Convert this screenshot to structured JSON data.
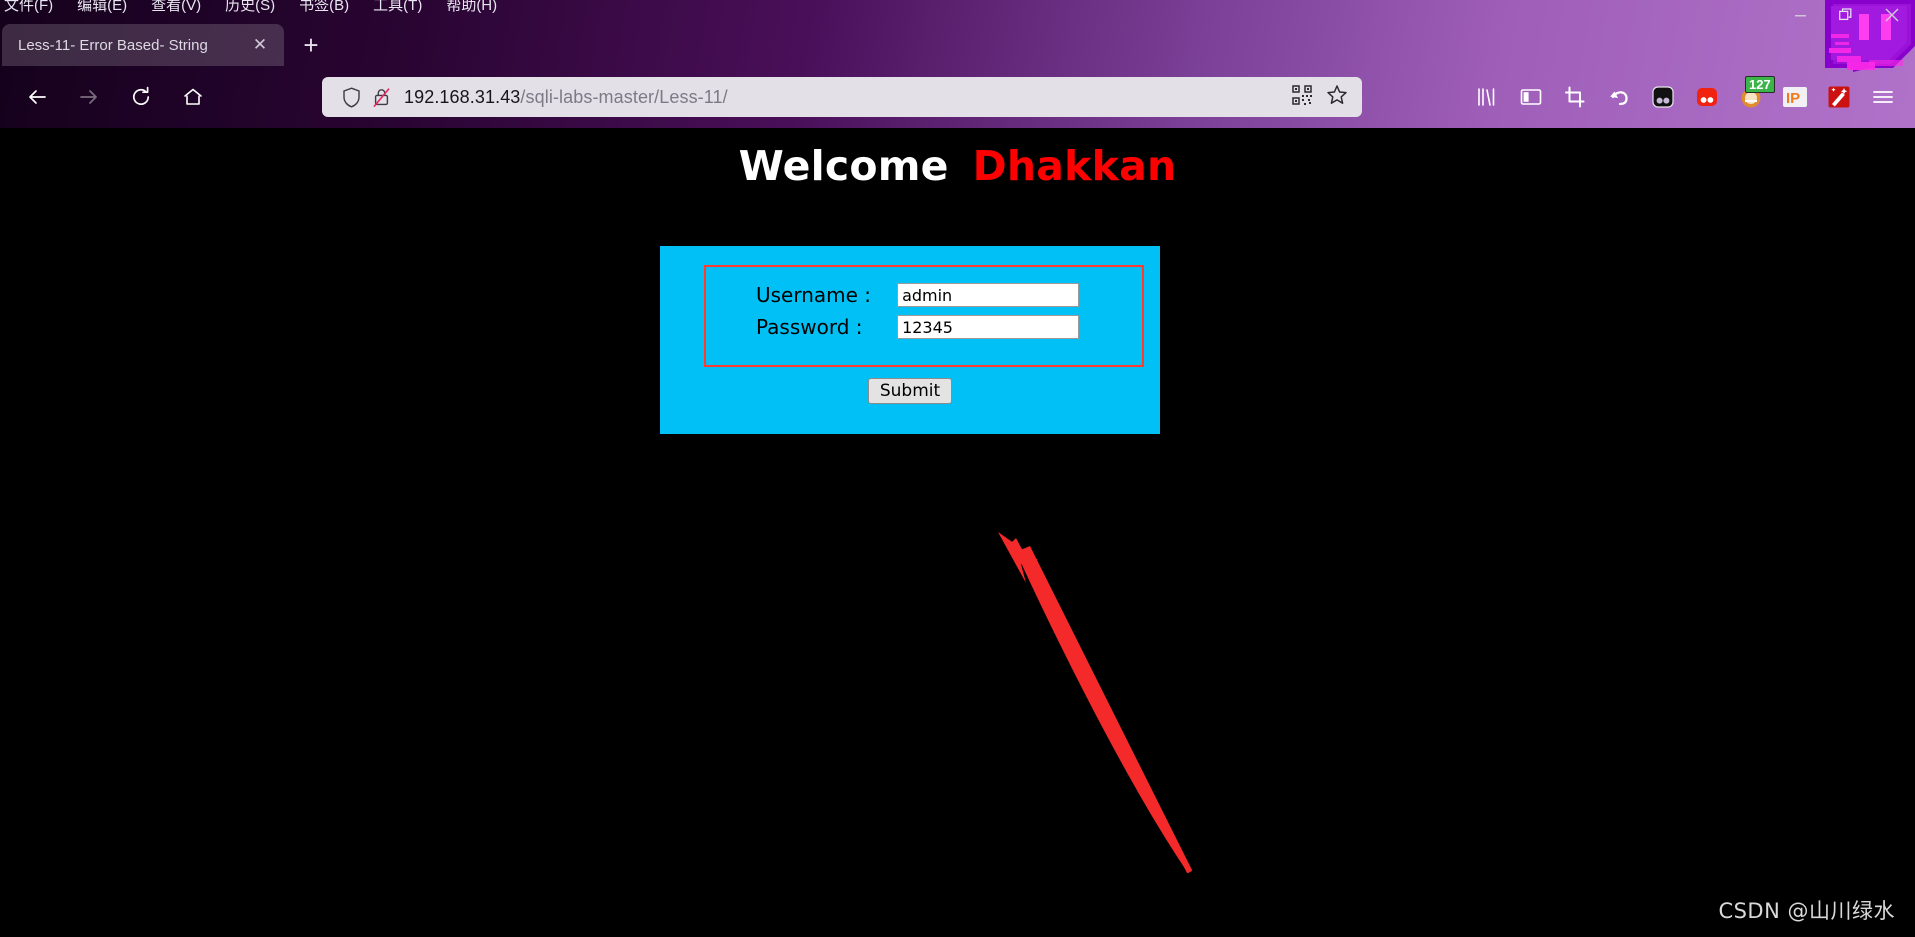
{
  "window": {
    "controls": [
      {
        "name": "minimize",
        "glyph": "—"
      },
      {
        "name": "restore",
        "glyph": "❐"
      },
      {
        "name": "close",
        "glyph": "✕"
      }
    ]
  },
  "menubar": {
    "items": [
      {
        "label": "文件(F)"
      },
      {
        "label": "编辑(E)"
      },
      {
        "label": "查看(V)"
      },
      {
        "label": "历史(S)"
      },
      {
        "label": "书签(B)"
      },
      {
        "label": "工具(T)"
      },
      {
        "label": "帮助(H)"
      }
    ]
  },
  "tabs": {
    "active": {
      "title": "Less-11- Error Based- String",
      "close_glyph": "✕"
    },
    "new_tab_glyph": "+"
  },
  "navigation": {
    "back": "back-arrow",
    "forward": "forward-arrow",
    "reload": "reload",
    "home": "home"
  },
  "urlbar": {
    "host": "192.168.31.43",
    "path": "/sqli-labs-master/Less-11/",
    "shield_icon": "shield-icon",
    "insecure_lock_icon": "lock-crossed-icon",
    "qr_icon": "qr-code-icon",
    "bookmark_icon": "star-icon"
  },
  "toolbar": {
    "items": [
      {
        "name": "library-icon",
        "label": "Library"
      },
      {
        "name": "sidebar-icon",
        "label": "Sidebar"
      },
      {
        "name": "crop-icon",
        "label": "Screenshot"
      },
      {
        "name": "undo-icon",
        "label": "Undo"
      },
      {
        "name": "extension-black-icon",
        "label": "Extension"
      },
      {
        "name": "extension-red-icon",
        "label": "Extension"
      },
      {
        "name": "extension-badge-icon",
        "label": "Extension",
        "badge": "127"
      },
      {
        "name": "ip-icon",
        "label": "IP"
      },
      {
        "name": "magic-wand-icon",
        "label": "Extension"
      },
      {
        "name": "menu-icon",
        "label": "Menu"
      }
    ]
  },
  "page": {
    "heading": {
      "welcome": "Welcome",
      "highlight": "Dhakkan"
    },
    "form": {
      "username_label": "Username :",
      "username_value": "admin",
      "password_label": "Password :",
      "password_value": "12345",
      "submit_label": "Submit"
    },
    "watermark": "CSDN @山川绿水"
  },
  "colors": {
    "form_background": "#00c0f5",
    "fieldset_border": "#ff3b30",
    "heading_highlight": "#ff0000",
    "annotation_arrow": "#f42a2a",
    "badge_green": "#3bb54a"
  }
}
